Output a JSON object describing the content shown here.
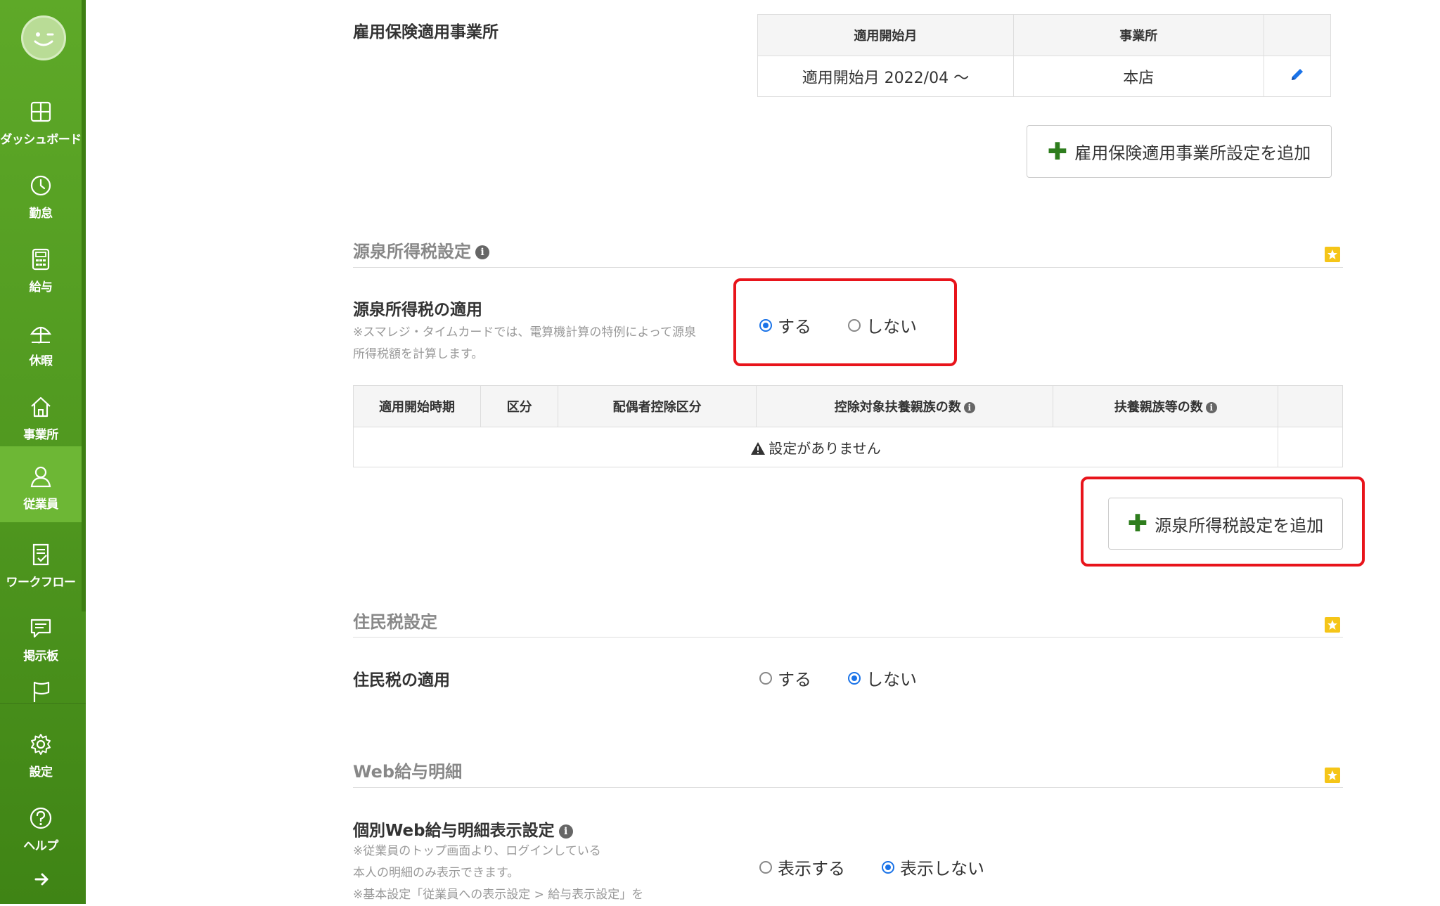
{
  "sidebar": {
    "items": [
      {
        "label": "ダッシュボード",
        "icon": "dashboard-icon"
      },
      {
        "label": "勤怠",
        "icon": "clock-icon"
      },
      {
        "label": "給与",
        "icon": "calculator-icon"
      },
      {
        "label": "休暇",
        "icon": "umbrella-icon"
      },
      {
        "label": "事業所",
        "icon": "home-icon"
      },
      {
        "label": "従業員",
        "icon": "person-icon"
      },
      {
        "label": "ワークフロー",
        "icon": "document-check-icon"
      },
      {
        "label": "掲示板",
        "icon": "message-icon"
      },
      {
        "label": "",
        "icon": "flag-icon"
      },
      {
        "label": "設定",
        "icon": "gear-icon"
      },
      {
        "label": "ヘルプ",
        "icon": "help-icon"
      }
    ],
    "active": "従業員",
    "expand_icon": "arrow-right-icon"
  },
  "employment_insurance": {
    "label": "雇用保険適用事業所",
    "table": {
      "headers": [
        "適用開始月",
        "事業所",
        ""
      ],
      "rows": [
        [
          "適用開始月 2022/04 〜",
          "本店"
        ]
      ]
    },
    "add_button": "雇用保険適用事業所設定を追加"
  },
  "withholding_tax": {
    "heading": "源泉所得税設定",
    "apply_label": "源泉所得税の適用",
    "note_line1": "※スマレジ・タイムカードでは、電算機計算の特例によって源泉",
    "note_line2": "所得税額を計算します。",
    "options": [
      "する",
      "しない"
    ],
    "selected": "する",
    "table": {
      "headers": [
        "適用開始時期",
        "区分",
        "配偶者控除区分",
        "控除対象扶養親族の数",
        "扶養親族等の数",
        ""
      ],
      "empty_message": "設定がありません"
    },
    "add_button": "源泉所得税設定を追加"
  },
  "resident_tax": {
    "heading": "住民税設定",
    "apply_label": "住民税の適用",
    "options": [
      "する",
      "しない"
    ],
    "selected": "しない"
  },
  "web_payslip": {
    "heading": "Web給与明細",
    "setting_label": "個別Web給与明細表示設定",
    "note_line1": "※従業員のトップ画面より、ログインしている",
    "note_line2": "本人の明細のみ表示できます。",
    "note_line3": "※基本設定「従業員への表示設定 > 給与表示設定」を",
    "options": [
      "表示する",
      "表示しない"
    ],
    "selected": "表示しない"
  },
  "colors": {
    "sidebar_green": "#5ea928",
    "highlight_red": "#e8141b",
    "radio_blue": "#1a73e8",
    "plus_green": "#2e7d1d"
  }
}
